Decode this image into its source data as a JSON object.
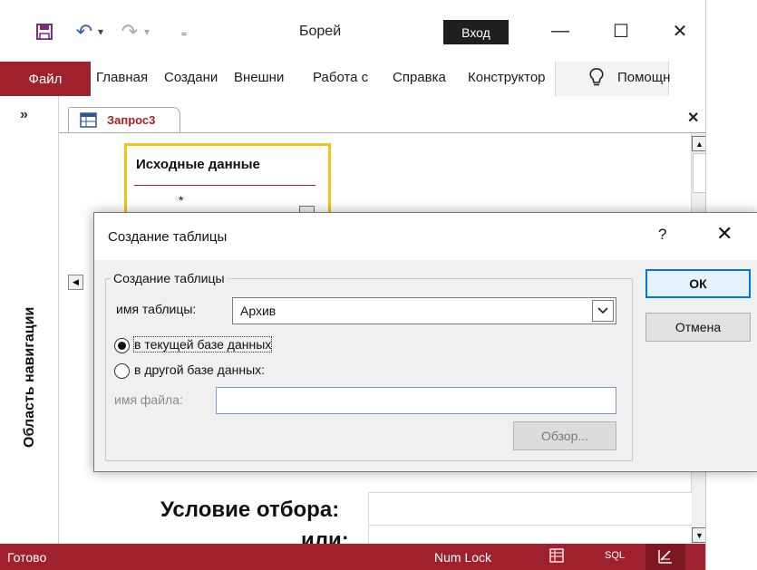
{
  "window": {
    "title": "Борей",
    "sign_in": "Вход",
    "minimize_glyph": "—",
    "maximize_glyph": "☐",
    "close_glyph": "✕"
  },
  "qat": {
    "save_icon": "save-icon",
    "undo_glyph": "↶",
    "redo_glyph": "↷",
    "dropdown_glyph": "▾",
    "customize_glyph": "₌"
  },
  "ribbon": {
    "file_tab": "Файл",
    "tabs": [
      "Главная",
      "Создани",
      "Внешни",
      "Работа с",
      "Справка",
      "Конструктор"
    ],
    "tell_me_icon": "lightbulb-icon",
    "tell_me": "Помощн",
    "accent": "#a0212e"
  },
  "nav": {
    "toggle": "»",
    "label": "Область навигации"
  },
  "document": {
    "tab_label": "Запрос3",
    "close_glyph": "✕",
    "table_box": {
      "title": "Исходные данные",
      "first_field": "*"
    },
    "grid_rows": [
      {
        "label": "Условие отбора:"
      },
      {
        "label": "или:"
      }
    ]
  },
  "status": {
    "ready": "Готово",
    "num_lock": "Num Lock",
    "datasheet_icon": "datasheet-view-icon",
    "sql": "SQL",
    "design_icon": "design-view-icon"
  },
  "dialog": {
    "title": "Создание таблицы",
    "help": "?",
    "close": "✕",
    "group_label": "Создание таблицы",
    "table_name_label": "имя таблицы:",
    "table_name_value": "Архив",
    "radio_current": "в текущей базе данных",
    "radio_other": "в другой базе данных:",
    "file_name_label": "имя файла:",
    "file_name_value": "",
    "browse": "Обзор...",
    "ok": "ОК",
    "cancel": "Отмена",
    "selected_option": "current"
  }
}
